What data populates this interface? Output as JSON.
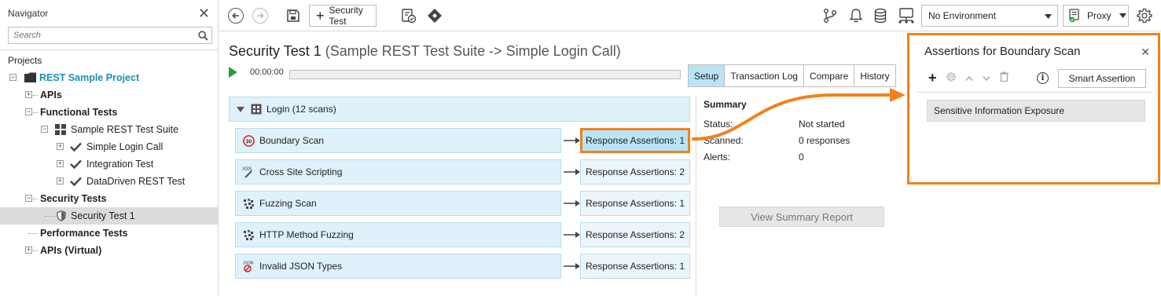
{
  "navigator": {
    "title": "Navigator",
    "search_placeholder": "Search",
    "projects_label": "Projects",
    "tree": [
      {
        "label": "REST Sample Project"
      },
      {
        "label": "APIs"
      },
      {
        "label": "Functional Tests"
      },
      {
        "label": "Sample REST Test Suite"
      },
      {
        "label": "Simple Login Call"
      },
      {
        "label": "Integration Test"
      },
      {
        "label": "DataDriven REST Test"
      },
      {
        "label": "Security Tests"
      },
      {
        "label": "Security Test 1"
      },
      {
        "label": "Performance Tests"
      },
      {
        "label": "APIs (Virtual)"
      }
    ]
  },
  "toolbar": {
    "security_test_label": "Security Test",
    "environment": "No Environment",
    "proxy_label": "Proxy"
  },
  "main": {
    "title": "Security Test 1",
    "subtitle": "(Sample REST Test Suite -> Simple Login Call)",
    "elapsed": "00:00:00",
    "progress": 0,
    "tabs": [
      {
        "label": "Setup",
        "active": true
      },
      {
        "label": "Transaction Log",
        "active": false
      },
      {
        "label": "Compare",
        "active": false
      },
      {
        "label": "History",
        "active": false
      }
    ],
    "group_label": "Login (12 scans)",
    "scans": [
      {
        "name": "Boundary Scan",
        "icon": "boundary-icon",
        "assertions": "Response Assertions: 1"
      },
      {
        "name": "Cross Site Scripting",
        "icon": "xss-icon",
        "assertions": "Response Assertions: 2"
      },
      {
        "name": "Fuzzing Scan",
        "icon": "fuzzing-icon",
        "assertions": "Response Assertions: 1"
      },
      {
        "name": "HTTP Method Fuzzing",
        "icon": "fuzzing-icon",
        "assertions": "Response Assertions: 2"
      },
      {
        "name": "Invalid JSON Types",
        "icon": "json-icon",
        "assertions": "Response Assertions: 1"
      }
    ],
    "summary": {
      "heading": "Summary",
      "rows": [
        {
          "key": "Status:",
          "value": "Not started"
        },
        {
          "key": "Scanned:",
          "value": "0 responses"
        },
        {
          "key": "Alerts:",
          "value": "0"
        }
      ],
      "view_report_label": "View Summary Report"
    }
  },
  "assertions_panel": {
    "title": "Assertions for Boundary Scan",
    "smart_assertion_label": "Smart Assertion",
    "items": [
      "Sensitive Information Exposure"
    ]
  },
  "colors": {
    "highlight": "#f0821e",
    "active_tab": "#b9e4f5",
    "project_teal": "#1b8fb0",
    "play_green": "#2a9d3a"
  }
}
